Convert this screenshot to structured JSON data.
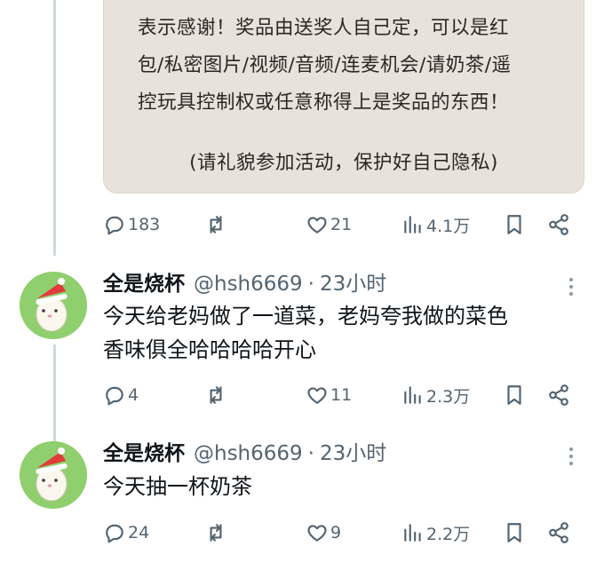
{
  "quoted_card": {
    "lines": [
      "表示感谢！奖品由送奖人自己定，可以是红",
      "包/私密图片/视频/音频/连麦机会/请奶茶/遥",
      "控玩具控制权或任意称得上是奖品的东西！"
    ],
    "note": "(请礼貌参加活动，保护好自己隐私)"
  },
  "post_actions": {
    "replies": "183",
    "likes": "21",
    "views": "4.1万"
  },
  "replies": [
    {
      "name": "全是烧杯",
      "handle": "@hsh6669",
      "separator": "·",
      "time": "23小时",
      "text_lines": [
        "今天给老妈做了一道菜，老妈夸我做的菜色",
        "香味俱全哈哈哈哈开心"
      ],
      "actions": {
        "replies": "4",
        "likes": "11",
        "views": "2.3万"
      }
    },
    {
      "name": "全是烧杯",
      "handle": "@hsh6669",
      "separator": "·",
      "time": "23小时",
      "text_lines": [
        "今天抽一杯奶茶"
      ],
      "actions": {
        "replies": "24",
        "likes": "9",
        "views": "2.2万"
      }
    }
  ],
  "icons": [
    "reply-icon",
    "retweet-icon",
    "like-icon",
    "views-icon",
    "bookmark-icon",
    "share-icon",
    "more-icon"
  ],
  "colors": {
    "card_bg": "#e9e2db",
    "muted": "#536471",
    "avatar_bg": "#8fcf6e"
  }
}
